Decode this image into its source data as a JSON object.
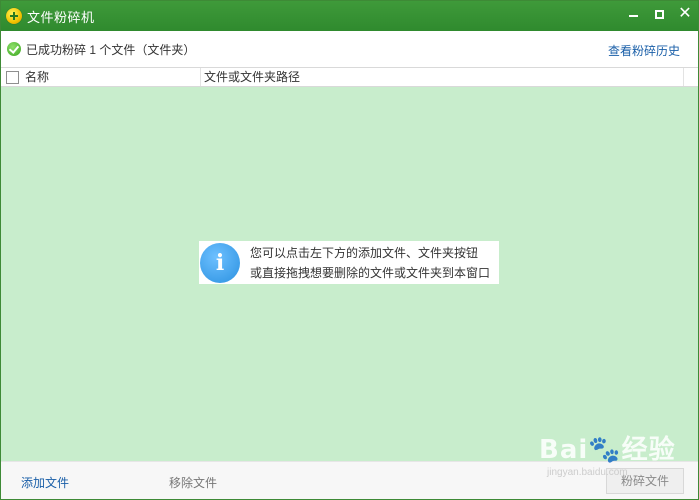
{
  "window": {
    "title": "文件粉碎机"
  },
  "status": {
    "message": "已成功粉碎 1 个文件（文件夹）",
    "history_link": "查看粉碎历史"
  },
  "table": {
    "columns": [
      "名称",
      "文件或文件夹路径"
    ]
  },
  "hint": {
    "line1": "您可以点击左下方的添加文件、文件夹按钮",
    "line2": "或直接拖拽想要删除的文件或文件夹到本窗口",
    "icon": "info-icon"
  },
  "footer": {
    "add_label": "添加文件",
    "remove_label": "移除文件",
    "shred_label": "粉碎文件"
  },
  "watermark": {
    "brand": "Bai🐾经验",
    "url": "jingyan.baidu.com"
  },
  "colors": {
    "titlebar": "#2f8a2e",
    "drop_area": "#c8edcc",
    "link": "#1a5fa8"
  }
}
